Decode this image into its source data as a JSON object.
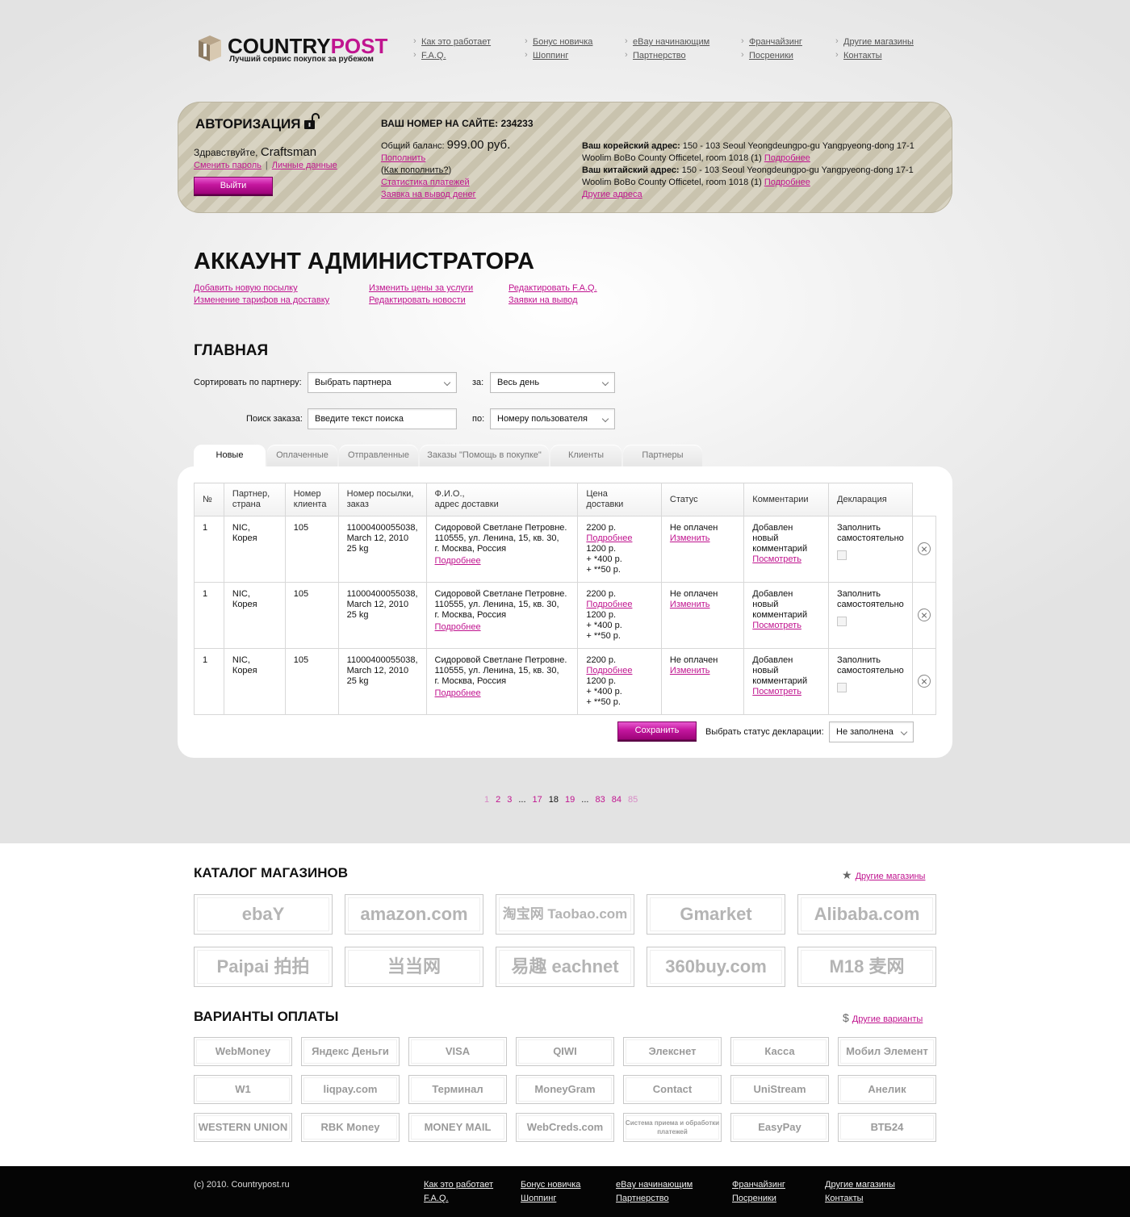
{
  "header": {
    "logo": {
      "part1": "COUNTRY",
      "part2": "POST",
      "tagline": "Лучший сервис покупок за рубежом"
    },
    "nav": [
      {
        "label": "Как это работает"
      },
      {
        "label": "F.A.Q."
      },
      {
        "label": "Бонус новичка"
      },
      {
        "label": "Шоппинг"
      },
      {
        "label": "eBay начинающим"
      },
      {
        "label": "Партнерство"
      },
      {
        "label": "Франчайзинг"
      },
      {
        "label": "Посреники"
      },
      {
        "label": "Другие магазины"
      },
      {
        "label": "Контакты"
      }
    ]
  },
  "auth": {
    "title": "АВТОРИЗАЦИЯ",
    "greeting": "Здравствуйте, ",
    "username": "Craftsman",
    "change_password": "Сменить пароль",
    "separator": "|",
    "personal_data": "Личные данные",
    "logout": "Выйти",
    "site_number": "ВАШ НОМЕР НА САЙТЕ: 234233",
    "balance_label": "Общий баланс: ",
    "balance_value": "999.00 руб.",
    "topup": "Пополнить",
    "how_topup_open": "(",
    "how_topup": "Как пополнить?",
    "how_topup_close": ")",
    "payment_stats": "Статистика платежей",
    "withdraw_request": "Заявка на вывод денег",
    "korean_label": "Ваш корейский адрес:",
    "korean_address": " 150 - 103 Seoul Yeongdeungpo-gu Yangpyeong-dong 17-1 Woolim BoBo County Officetel, room 1018 (1) ",
    "chinese_label": "Ваш китайский адрес:",
    "chinese_address": " 150 - 103 Seoul Yeongdeungpo-gu Yangpyeong-dong 17-1 Woolim BoBo County Officetel, room 1018 (1) ",
    "more": "Подробнее",
    "other_addresses": "Другие адреса"
  },
  "admin": {
    "title": "АККАУНТ АДМИНИСТРАТОРА",
    "links": [
      "Добавить новую посылку",
      "Изменение тарифов на доставку",
      "Изменить цены за услуги",
      "Редактировать новости",
      "Редактировать F.A.Q.",
      "Заявки на вывод"
    ]
  },
  "main": {
    "title": "ГЛАВНАЯ",
    "sort_label": "Сортировать по партнеру:",
    "partner_select": "Выбрать партнера",
    "for_label": "за:",
    "period_select": "Весь день",
    "search_label": "Поиск заказа:",
    "search_placeholder": "Введите текст поиска",
    "by_label": "по:",
    "by_select": "Номеру пользователя",
    "tabs": [
      "Новые",
      "Оплаченные",
      "Отправленные",
      "Заказы \"Помощь в покупке\"",
      "Клиенты",
      "Партнеры"
    ]
  },
  "table": {
    "headers": [
      "№",
      "Партнер,\nстрана",
      "Номер\nклиента",
      "Номер посылки,\nзаказ",
      "Ф.И.О.,\nадрес доставки",
      "Цена\nдоставки",
      "Статус",
      "Комментарии",
      "Декларация"
    ],
    "rows": [
      {
        "num": "1",
        "partner": "NIC,\nКорея",
        "client": "105",
        "parcel": "11000400055038,\nMarch 12, 2010\n25 kg",
        "name": "Сидоровой Светлане Петровне.\n110555, ул. Ленина, 15, кв. 30,\nг. Москва, Россия",
        "more": "Подробнее",
        "price1": "2200 р.",
        "price_more": "Подробнее",
        "price2": "1200 р.\n+ *400 р.\n+ **50 р.",
        "status": "Не оплачен",
        "change": "Изменить",
        "comment": "Добавлен новый\nкомментарий",
        "view": "Посмотреть",
        "decl": "Заполнить\nсамостоятельно"
      },
      {
        "num": "1",
        "partner": "NIC,\nКорея",
        "client": "105",
        "parcel": "11000400055038,\nMarch 12, 2010\n25 kg",
        "name": "Сидоровой Светлане Петровне.\n110555, ул. Ленина, 15, кв. 30,\nг. Москва, Россия",
        "more": "Подробнее",
        "price1": "2200 р.",
        "price_more": "Подробнее",
        "price2": "1200 р.\n+ *400 р.\n+ **50 р.",
        "status": "Не оплачен",
        "change": "Изменить",
        "comment": "Добавлен новый\nкомментарий",
        "view": "Посмотреть",
        "decl": "Заполнить\nсамостоятельно"
      },
      {
        "num": "1",
        "partner": "NIC,\nКорея",
        "client": "105",
        "parcel": "11000400055038,\nMarch 12, 2010\n25 kg",
        "name": "Сидоровой Светлане Петровне.\n110555, ул. Ленина, 15, кв. 30,\nг. Москва, Россия",
        "more": "Подробнее",
        "price1": "2200 р.",
        "price_more": "Подробнее",
        "price2": "1200 р.\n+ *400 р.\n+ **50 р.",
        "status": "Не оплачен",
        "change": "Изменить",
        "comment": "Добавлен новый\nкомментарий",
        "view": "Посмотреть",
        "decl": "Заполнить\nсамостоятельно"
      }
    ],
    "save": "Сохранить",
    "decl_status_label": "Выбрать статус декларации:",
    "decl_status_select": "Не заполнена"
  },
  "pager": [
    "1",
    "2",
    "3",
    "...",
    "17",
    "18",
    "19",
    "...",
    "83",
    "84",
    "85"
  ],
  "catalog": {
    "title": "КАТАЛОГ МАГАЗИНОВ",
    "more": "Другие магазины",
    "shops": [
      "ebaY",
      "amazon.com",
      "淘宝网 Taobao.com",
      "Gmarket",
      "Alibaba.com",
      "Paipai 拍拍",
      "当当网",
      "易趣 eachnet",
      "360buy.com",
      "M18 麦网"
    ]
  },
  "payments": {
    "title": "ВАРИАНТЫ ОПЛАТЫ",
    "more": "Другие варианты",
    "items": [
      "WebMoney",
      "Яндекс Деньги",
      "VISA",
      "QIWI",
      "Элекснет",
      "Касса",
      "Мобил Элемент",
      "W1",
      "liqpay.com",
      "Терминал",
      "MoneyGram",
      "Contact",
      "UniStream",
      "Анелик",
      "WESTERN UNION",
      "RBK Money",
      "MONEY MAIL",
      "WebCreds.com",
      "Система приема и обработки платежей",
      "EasyPay",
      "ВТБ24"
    ]
  },
  "footer": {
    "copyright": "(c) 2010. Countrypost.ru",
    "nav": [
      {
        "label": "Как это работает"
      },
      {
        "label": "F.A.Q."
      },
      {
        "label": "Бонус новичка"
      },
      {
        "label": "Шоппинг"
      },
      {
        "label": "eBay начинающим"
      },
      {
        "label": "Партнерство"
      },
      {
        "label": "Франчайзинг"
      },
      {
        "label": "Посреники"
      },
      {
        "label": "Другие магазины"
      },
      {
        "label": "Контакты"
      }
    ]
  },
  "colors": {
    "accent": "#c0148f",
    "footer_bg": "#050505",
    "auth_stripe": "#d8d3c2"
  }
}
